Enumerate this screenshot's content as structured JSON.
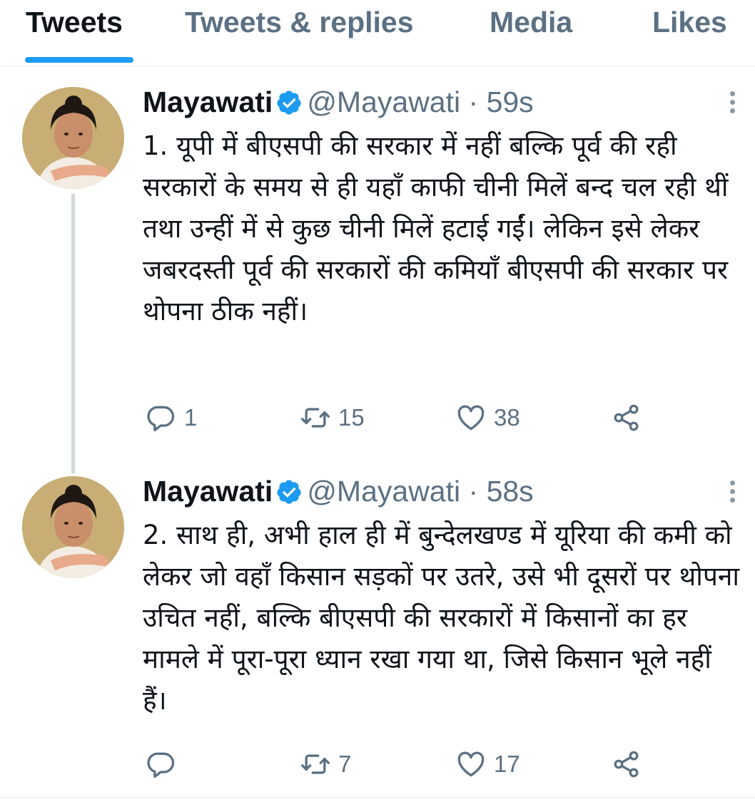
{
  "tabs": [
    {
      "label": "Tweets",
      "active": true
    },
    {
      "label": "Tweets & replies",
      "active": false
    },
    {
      "label": "Media",
      "active": false
    },
    {
      "label": "Likes",
      "active": false
    }
  ],
  "accent_color": "#1d9bf0",
  "tweets": [
    {
      "name": "Mayawati",
      "handle": "@Mayawati",
      "separator": "·",
      "time": "59s",
      "text": "1. यूपी में बीएसपी की सरकार में नहीं बल्कि पूर्व की रही सरकारों के समय से ही यहाँ काफी चीनी मिलें बन्द चल रही थीं तथा उन्हीं में से कुछ चीनी मिलें हटाई गईं। लेकिन इसे लेकर जबरदस्ती पूर्व की सरकारों की कमियाँ बीएसपी की सरकार पर थोपना ठीक नहीं।",
      "replies": "1",
      "retweets": "15",
      "likes": "38"
    },
    {
      "name": "Mayawati",
      "handle": "@Mayawati",
      "separator": "·",
      "time": "58s",
      "text": "2. साथ ही, अभी हाल ही में बुन्देलखण्ड में यूरिया की कमी को लेकर जो वहाँ किसान सड़कों पर उतरे, उसे भी दूसरों पर थोपना उचित नहीं, बल्कि बीएसपी की सरकारों में किसानों का हर मामले में पूरा-पूरा ध्यान रखा गया था, जिसे किसान भूले नहीं हैं।",
      "replies": "",
      "retweets": "7",
      "likes": "17"
    }
  ]
}
